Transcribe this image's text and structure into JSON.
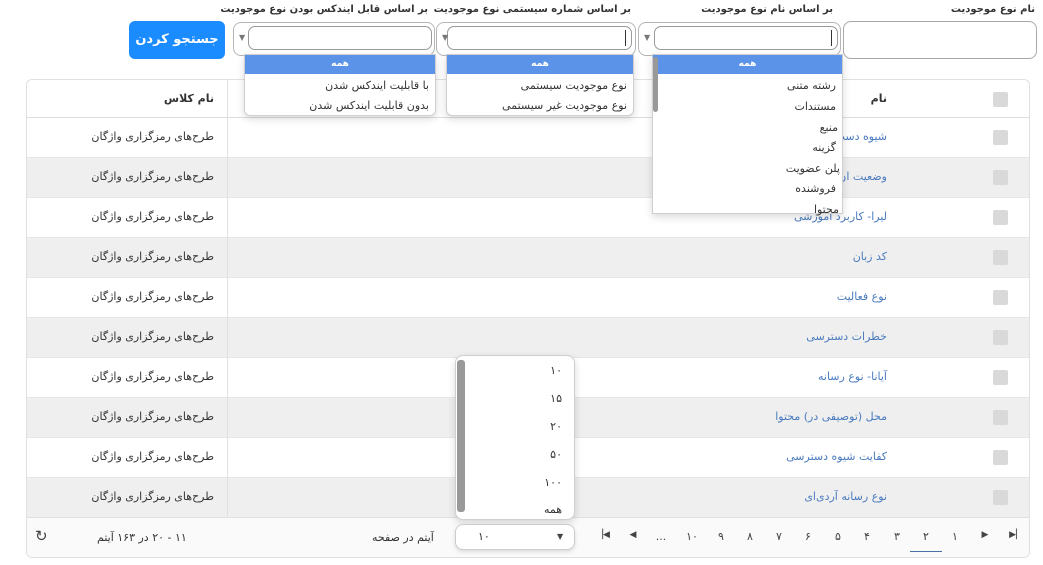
{
  "filters": {
    "type_name_label": "نام نوع موجودیت",
    "by_type_name_label": "بر اساس نام نوع موجودیت",
    "by_system_number_label": "بر اساس شماره سیستمی نوع موجودیت",
    "by_indexable_label": "بر اساس قابل ایندکس بودن نوع موجودیت",
    "search_button": "جستجو کردن",
    "by_type_name_options": [
      "همه",
      "رشته متنی",
      "مستندات",
      "منبع",
      "گزینه",
      "پلن عضویت",
      "فروشنده",
      "محتوا"
    ],
    "by_system_number_options": [
      "همه",
      "نوع موجودیت سیستمی",
      "نوع موجودیت غیر سیستمی"
    ],
    "by_indexable_options": [
      "همه",
      "با قابلیت ایندکس شدن",
      "بدون قابلیت ایندکس شدن"
    ]
  },
  "table": {
    "col_name": "نام",
    "col_class": "نام کلاس",
    "rows": [
      {
        "name": "شیوه دست",
        "class": "طرح‌های رمزگزاری واژگان"
      },
      {
        "name": "وضعیت ان",
        "class": "طرح‌های رمزگزاری واژگان"
      },
      {
        "name": "لیرا- کاربرد آموزشی",
        "class": "طرح‌های رمزگزاری واژگان"
      },
      {
        "name": "کد زبان",
        "class": "طرح‌های رمزگزاری واژگان"
      },
      {
        "name": "نوع فعالیت",
        "class": "طرح‌های رمزگزاری واژگان"
      },
      {
        "name": "خطرات دسترسی",
        "class": "طرح‌های رمزگزاری واژگان"
      },
      {
        "name": "آیانا- نوع رسانه",
        "class": "طرح‌های رمزگزاری واژگان"
      },
      {
        "name": "محل (توصیفی در) محتوا",
        "class": "طرح‌های رمزگزاری واژگان"
      },
      {
        "name": "کفایت شیوه دسترسی",
        "class": "طرح‌های رمزگزاری واژگان"
      },
      {
        "name": "نوع رسانه آردی‌ای",
        "class": "طرح‌های رمزگزاری واژگان"
      }
    ]
  },
  "pager": {
    "pages": [
      "۱",
      "۲",
      "۳",
      "۴",
      "۵",
      "۶",
      "۷",
      "۸",
      "۹",
      "۱۰",
      "..."
    ],
    "active_page": "۲",
    "items_per_page_label": "آیتم در صفحه",
    "page_size": "۱۰",
    "page_size_options": [
      "۱۰",
      "۱۵",
      "۲۰",
      "۵۰",
      "۱۰۰",
      "همه"
    ],
    "range_text": "۱۱ - ۲۰ در ۱۶۳ آیتم"
  }
}
